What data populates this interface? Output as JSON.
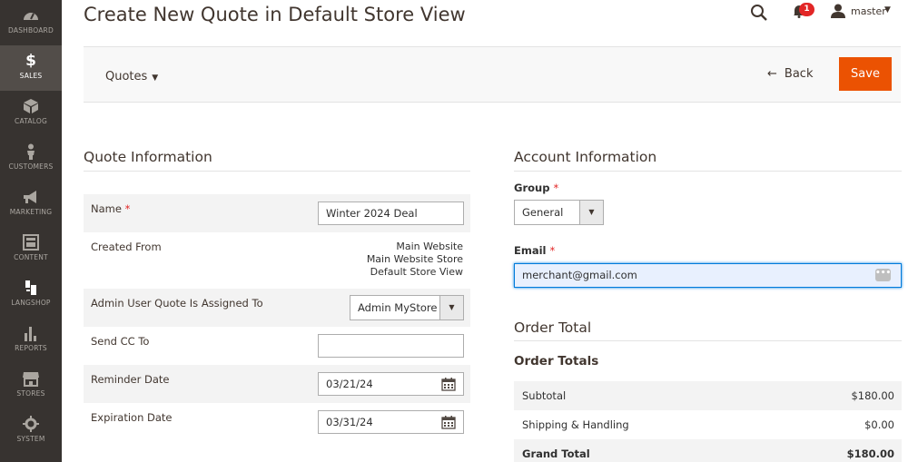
{
  "sidebar": {
    "items": [
      {
        "label": "DASHBOARD",
        "icon": "dashboard-icon"
      },
      {
        "label": "SALES",
        "icon": "dollar-icon",
        "glyph": "$",
        "active": true
      },
      {
        "label": "CATALOG",
        "icon": "box-icon"
      },
      {
        "label": "CUSTOMERS",
        "icon": "person-icon"
      },
      {
        "label": "MARKETING",
        "icon": "megaphone-icon"
      },
      {
        "label": "CONTENT",
        "icon": "layout-icon"
      },
      {
        "label": "LANGSHOP",
        "icon": "translate-icon"
      },
      {
        "label": "REPORTS",
        "icon": "bar-chart-icon"
      },
      {
        "label": "STORES",
        "icon": "storefront-icon"
      },
      {
        "label": "SYSTEM",
        "icon": "gear-icon"
      }
    ]
  },
  "header": {
    "title": "Create New Quote in Default Store View",
    "notification_count": "1",
    "username": "master"
  },
  "toolbar": {
    "switcher_label": "Quotes",
    "back_label": "Back",
    "save_label": "Save"
  },
  "quote_info": {
    "title": "Quote Information",
    "name_label": "Name",
    "name_value": "Winter 2024 Deal",
    "created_from_label": "Created From",
    "created_from": [
      "Main Website",
      "Main Website Store",
      "Default Store View"
    ],
    "admin_user_label": "Admin User Quote Is Assigned To",
    "admin_user_value": "Admin MyStore",
    "send_cc_label": "Send CC To",
    "send_cc_value": "",
    "reminder_label": "Reminder Date",
    "reminder_value": "03/21/24",
    "expiration_label": "Expiration Date",
    "expiration_value": "03/31/24"
  },
  "account_info": {
    "title": "Account Information",
    "group_label": "Group",
    "group_value": "General",
    "email_label": "Email",
    "email_value": "merchant@gmail.com"
  },
  "order_total": {
    "title": "Order Total",
    "subtitle": "Order Totals",
    "rows": [
      {
        "label": "Subtotal",
        "value": "$180.00"
      },
      {
        "label": "Shipping & Handling",
        "value": "$0.00"
      },
      {
        "label": "Grand Total",
        "value": "$180.00"
      }
    ]
  },
  "colors": {
    "sidebar_bg": "#373330",
    "sidebar_active": "#524d49",
    "accent": "#eb5202",
    "required": "#e22626"
  }
}
